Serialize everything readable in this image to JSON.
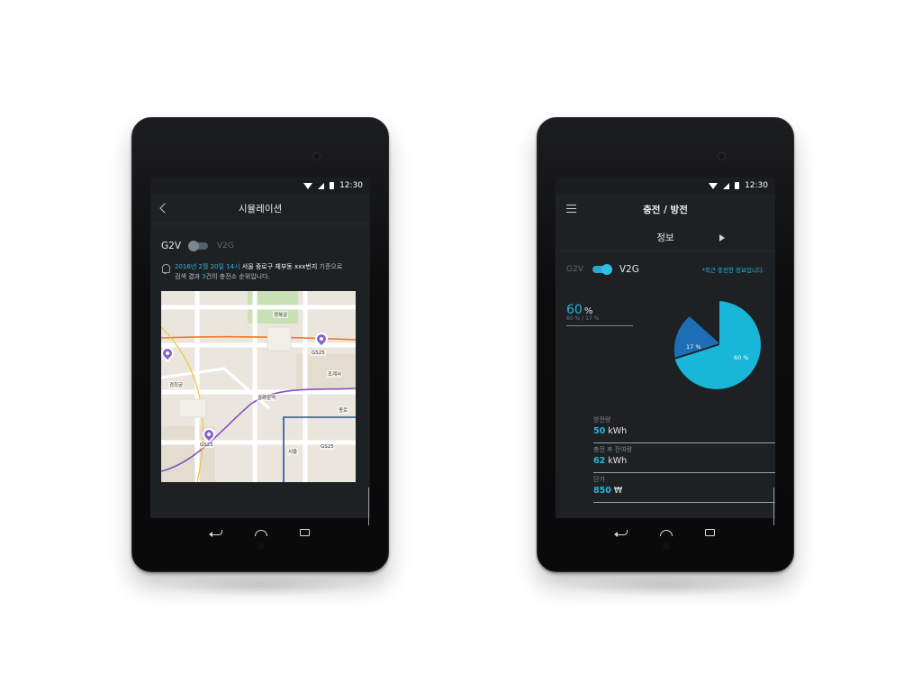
{
  "colors": {
    "accent": "#2ab3de",
    "screen_bg": "#1e2124",
    "pie_large": "#18b6d9",
    "pie_small": "#1c6fb4",
    "pin": "#8a5fd0"
  },
  "status_bar": {
    "time": "12:30"
  },
  "left_screen": {
    "title": "시뮬레이션",
    "toggle": {
      "on_label": "G2V",
      "off_label": "V2G"
    },
    "notice": {
      "date": "2016년 2월 20일 14시",
      "address": "서울 중로구 체부동 xxx번지",
      "suffix": " 기준으로",
      "line2_a": "검색 결과 ",
      "count": "3",
      "line2_b": "건의 충전소 순위입니다."
    },
    "map": {
      "labels": [
        "GS25",
        "GS25",
        "GS25",
        "광화문역",
        "경복궁",
        "경희궁",
        "조계사",
        "종로",
        "서울"
      ]
    }
  },
  "right_screen": {
    "title": "충전 / 방전",
    "tab": "정보",
    "toggle": {
      "off_label": "G2V",
      "on_label": "V2G"
    },
    "recent_note": "*최근 충전한 정보입니다.",
    "percent": {
      "value": "60",
      "sign": "%",
      "sub": "60 % / 17 %"
    },
    "pie": {
      "slices": [
        {
          "label": "60 %",
          "value": 60
        },
        {
          "label": "17 %",
          "value": 17
        }
      ]
    },
    "info": [
      {
        "label": "방전량",
        "value": "50",
        "unit": "kWh"
      },
      {
        "label": "충전 후 잔여량",
        "value": "62",
        "unit": "kWh"
      },
      {
        "label": "단가",
        "value": "850",
        "unit": "₩"
      }
    ]
  }
}
